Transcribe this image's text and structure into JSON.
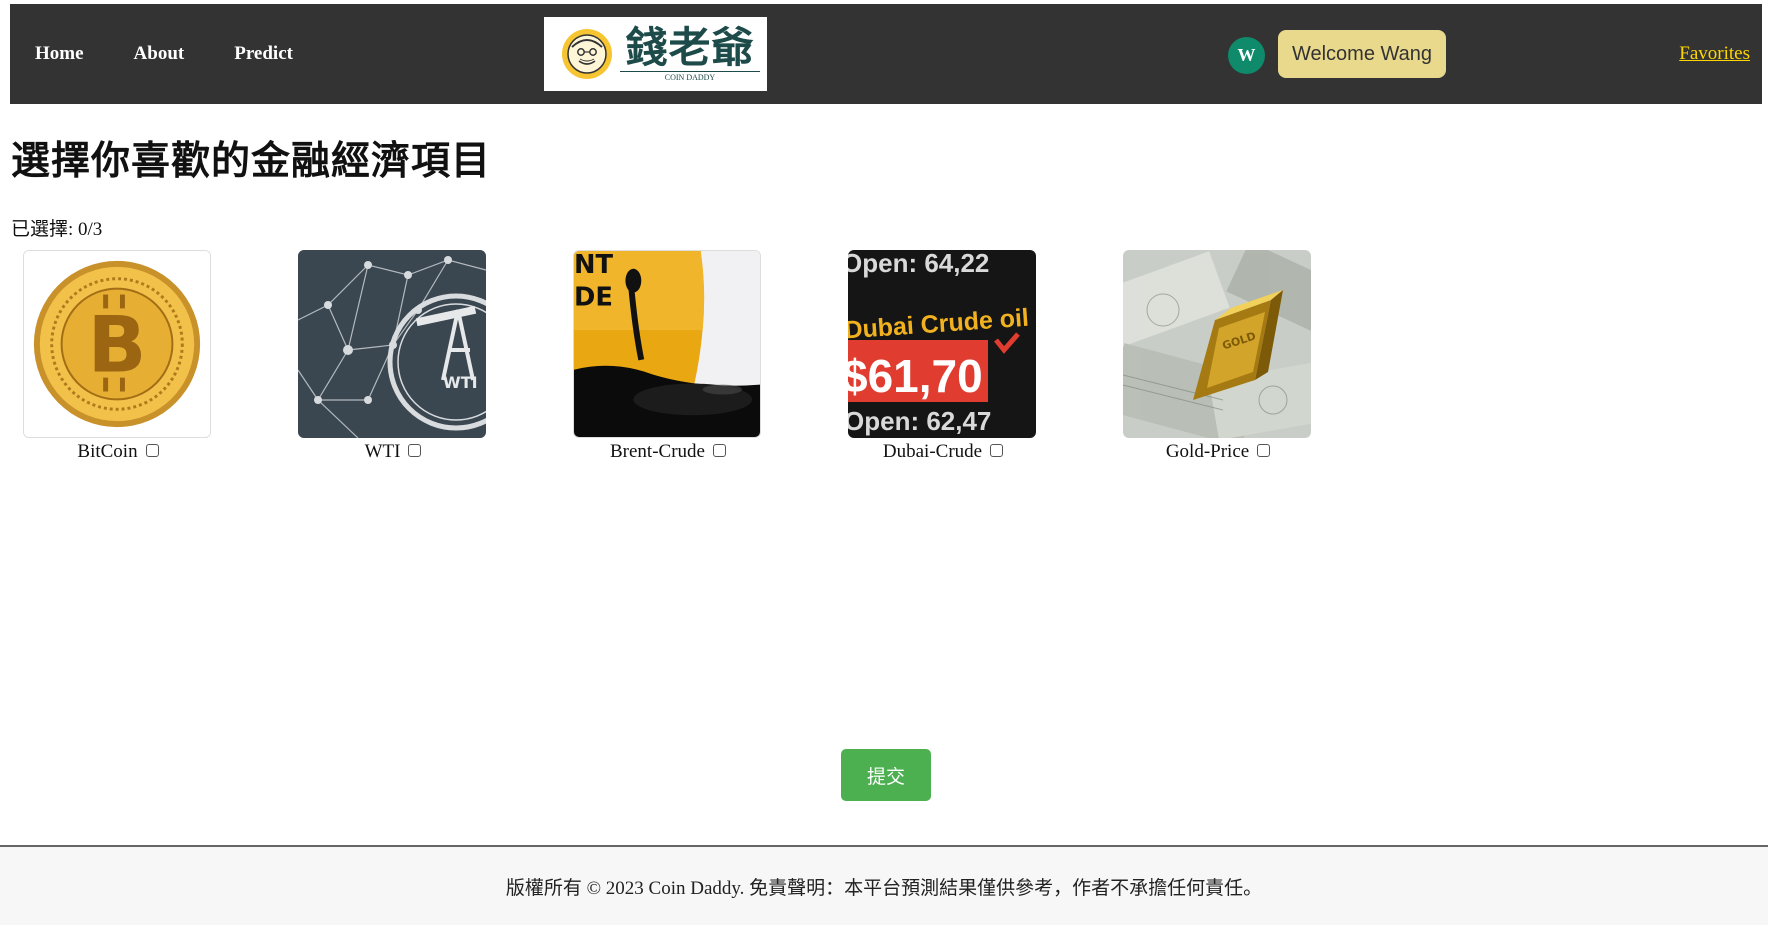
{
  "nav": {
    "links": [
      {
        "label": "Home"
      },
      {
        "label": "About"
      },
      {
        "label": "Predict"
      }
    ],
    "logo": {
      "title": "錢老爺",
      "subtitle": "COIN DADDY"
    },
    "avatar_initial": "W",
    "welcome": "Welcome Wang",
    "favorites": "Favorites"
  },
  "main": {
    "title": "選擇你喜歡的金融經濟項目",
    "selected_label": "已選擇: 0/3",
    "items": [
      {
        "label": "BitCoin",
        "checked": false,
        "icon": "bitcoin-coin-image"
      },
      {
        "label": "WTI",
        "checked": false,
        "icon": "wti-oil-pump-image"
      },
      {
        "label": "Brent-Crude",
        "checked": false,
        "icon": "oil-barrel-spill-image"
      },
      {
        "label": "Dubai-Crude",
        "checked": false,
        "icon": "dubai-crude-ticker-image",
        "image_text": {
          "line1": "Open: 64,22",
          "line2": "Dubai Crude oil",
          "price": "$61,70",
          "line3": "Open: 62,47"
        }
      },
      {
        "label": "Gold-Price",
        "checked": false,
        "icon": "gold-bar-money-image",
        "image_text": "GOLD"
      }
    ],
    "submit": "提交"
  },
  "footer": {
    "text": "版權所有 © 2023 Coin Daddy. 免責聲明：本平台預測結果僅供參考，作者不承擔任何責任。"
  },
  "colors": {
    "navbar": "#333333",
    "welcome_bg": "#e8d98c",
    "avatar_bg": "#0f8a6a",
    "favorites": "#ffd700",
    "submit_bg": "#4caf50"
  }
}
